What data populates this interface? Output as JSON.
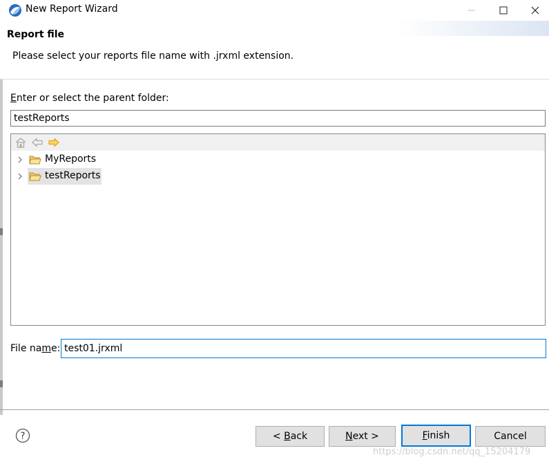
{
  "window": {
    "title": "New Report Wizard",
    "controls": {
      "minimize": "—",
      "maximize": "☐",
      "close": "✕"
    }
  },
  "banner": {
    "title": "Report file",
    "description": "Please select your reports file name with .jrxml extension."
  },
  "folder": {
    "label_pre": "",
    "label_key": "E",
    "label_post": "nter or select the parent folder:",
    "value": "testReports"
  },
  "tree": {
    "toolbar": [
      "home-icon",
      "back-arrow-icon",
      "forward-arrow-icon"
    ],
    "items": [
      {
        "label": "MyReports",
        "icon": "folder-icon",
        "expanded": false,
        "selected": false
      },
      {
        "label": "testReports",
        "icon": "folder-icon",
        "expanded": false,
        "selected": true
      }
    ]
  },
  "file_name": {
    "label_pre": "File na",
    "label_key": "m",
    "label_post": "e:",
    "value": "test01.jrxml"
  },
  "buttons": {
    "back": {
      "pre": "< ",
      "key": "B",
      "post": "ack"
    },
    "next": {
      "pre": "",
      "key": "N",
      "post": "ext >"
    },
    "finish": {
      "pre": "",
      "key": "F",
      "post": "inish"
    },
    "cancel": {
      "pre": "",
      "key": "",
      "post": "Cancel"
    }
  },
  "watermark": "https://blog.csdn.net/qq_15204179",
  "colors": {
    "accent": "#0078d7",
    "folder": "#d9a93a",
    "forward_arrow": "#e8a317"
  }
}
